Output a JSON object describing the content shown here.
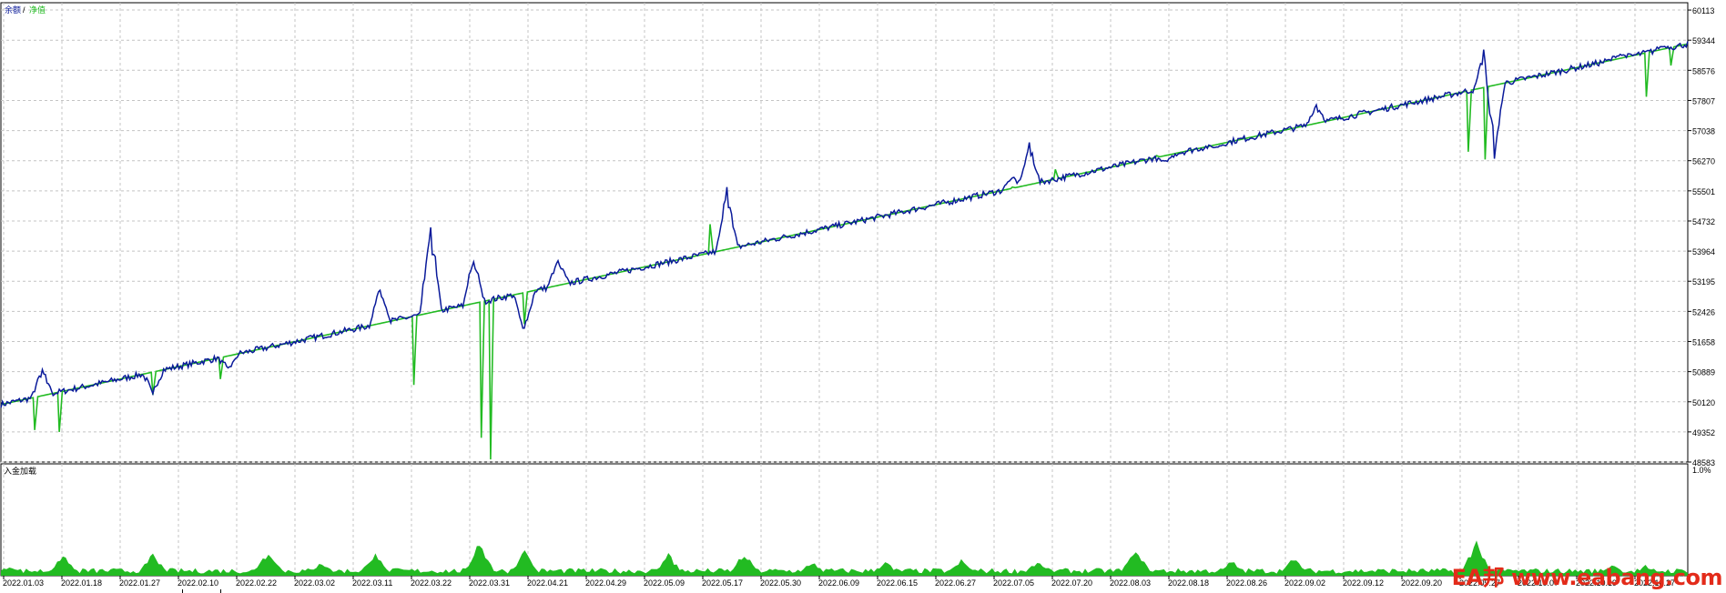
{
  "legend": {
    "balance_label": "余额",
    "separator": "/",
    "equity_label": "净值"
  },
  "indicator": {
    "label": "入金加载",
    "max_label": "1.0%"
  },
  "watermark": "EA邦 www.eabang.com",
  "colors": {
    "balance": "#22bb22",
    "equity": "#0a1a9a",
    "load": "#22bb22",
    "grid": "#c4c4c4",
    "frame": "#000000",
    "watermark": "#e32b1a"
  },
  "chart_data": [
    {
      "type": "line",
      "grid": true,
      "y_ticks": [
        60113,
        59344,
        58576,
        57807,
        57038,
        56270,
        55501,
        54732,
        53964,
        53195,
        52426,
        51658,
        50889,
        50120,
        49352,
        48583
      ],
      "ylim": [
        48583,
        60300
      ],
      "x_ticks": [
        "2022.01.03",
        "2022.01.18",
        "2022.01.27",
        "2022.02.10",
        "2022.02.22",
        "2022.03.02",
        "2022.03.11",
        "2022.03.22",
        "2022.03.31",
        "2022.04.21",
        "2022.04.29",
        "2022.05.09",
        "2022.05.17",
        "2022.05.30",
        "2022.06.09",
        "2022.06.15",
        "2022.06.27",
        "2022.07.05",
        "2022.07.20",
        "2022.08.03",
        "2022.08.18",
        "2022.08.26",
        "2022.09.02",
        "2022.09.12",
        "2022.09.20",
        "2022.09.27",
        "2022.10.07",
        "2022.10.19",
        "2022.10.27"
      ],
      "series": [
        {
          "name": "余额",
          "trend_start": 50050,
          "trend_end": 59250,
          "drops": [
            [
              0.02,
              49400
            ],
            [
              0.035,
              49350
            ],
            [
              0.09,
              50300
            ],
            [
              0.13,
              50700
            ],
            [
              0.245,
              50550
            ],
            [
              0.285,
              49200
            ],
            [
              0.29,
              48650
            ],
            [
              0.31,
              52100
            ],
            [
              0.42,
              54650
            ],
            [
              0.6,
              55600
            ],
            [
              0.625,
              56050
            ],
            [
              0.685,
              56400
            ],
            [
              0.87,
              56500
            ],
            [
              0.88,
              56300
            ],
            [
              0.975,
              57900
            ],
            [
              0.99,
              58700
            ]
          ]
        },
        {
          "name": "净值",
          "excursions": [
            [
              0.025,
              51000
            ],
            [
              0.09,
              50300
            ],
            [
              0.135,
              50900
            ],
            [
              0.225,
              53200
            ],
            [
              0.255,
              54900
            ],
            [
              0.28,
              54000
            ],
            [
              0.31,
              51800
            ],
            [
              0.33,
              53800
            ],
            [
              0.43,
              55650
            ],
            [
              0.6,
              55900
            ],
            [
              0.61,
              56800
            ],
            [
              0.69,
              56200
            ],
            [
              0.72,
              56600
            ],
            [
              0.78,
              57700
            ],
            [
              0.88,
              59300
            ],
            [
              0.885,
              56300
            ],
            [
              0.96,
              59000
            ],
            [
              0.985,
              59200
            ]
          ]
        }
      ]
    },
    {
      "type": "area",
      "title": "入金加载",
      "ylim": [
        0,
        1.0
      ],
      "y_ticks_label": "1.0%",
      "peaks": [
        [
          0.005,
          0.09
        ],
        [
          0.036,
          0.2
        ],
        [
          0.09,
          0.22
        ],
        [
          0.158,
          0.25
        ],
        [
          0.19,
          0.14
        ],
        [
          0.222,
          0.24
        ],
        [
          0.283,
          0.33
        ],
        [
          0.31,
          0.24
        ],
        [
          0.395,
          0.21
        ],
        [
          0.44,
          0.24
        ],
        [
          0.48,
          0.14
        ],
        [
          0.525,
          0.14
        ],
        [
          0.57,
          0.16
        ],
        [
          0.615,
          0.14
        ],
        [
          0.672,
          0.27
        ],
        [
          0.73,
          0.16
        ],
        [
          0.767,
          0.17
        ],
        [
          0.875,
          0.34
        ],
        [
          0.955,
          0.12
        ],
        [
          0.975,
          0.1
        ]
      ]
    }
  ]
}
